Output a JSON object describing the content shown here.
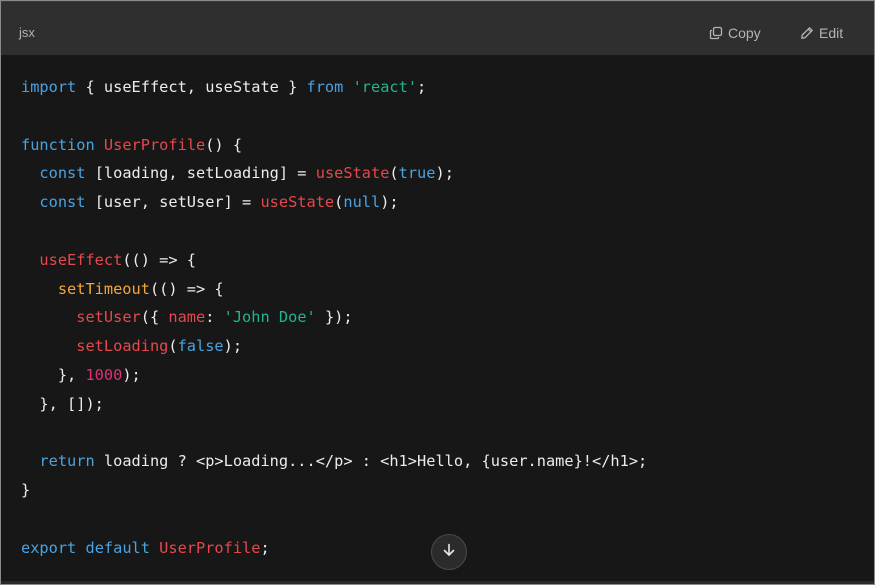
{
  "header": {
    "language": "jsx",
    "copy_label": "Copy",
    "edit_label": "Edit"
  },
  "icons": {
    "copy": "copy-icon",
    "edit": "pencil-icon",
    "scroll": "arrow-down-icon"
  },
  "colors": {
    "keyword": "#4aa3e0",
    "function": "#e5484d",
    "string": "#1fb58f",
    "number": "#df3079",
    "timeout": "#f2a73b",
    "text": "#ececec",
    "background": "#171717",
    "header_background": "#2f2f2f"
  },
  "code": {
    "lines": [
      [
        {
          "t": "import",
          "c": "keyword"
        },
        {
          "t": " { useEffect, useState } ",
          "c": "plain"
        },
        {
          "t": "from",
          "c": "keyword"
        },
        {
          "t": " ",
          "c": "plain"
        },
        {
          "t": "'react'",
          "c": "string"
        },
        {
          "t": ";",
          "c": "plain"
        }
      ],
      [],
      [
        {
          "t": "function",
          "c": "keyword"
        },
        {
          "t": " ",
          "c": "plain"
        },
        {
          "t": "UserProfile",
          "c": "func"
        },
        {
          "t": "() {",
          "c": "plain"
        }
      ],
      [
        {
          "t": "  ",
          "c": "plain"
        },
        {
          "t": "const",
          "c": "keyword"
        },
        {
          "t": " [loading, setLoading] = ",
          "c": "plain"
        },
        {
          "t": "useState",
          "c": "func"
        },
        {
          "t": "(",
          "c": "plain"
        },
        {
          "t": "true",
          "c": "bool"
        },
        {
          "t": ");",
          "c": "plain"
        }
      ],
      [
        {
          "t": "  ",
          "c": "plain"
        },
        {
          "t": "const",
          "c": "keyword"
        },
        {
          "t": " [user, setUser] = ",
          "c": "plain"
        },
        {
          "t": "useState",
          "c": "func"
        },
        {
          "t": "(",
          "c": "plain"
        },
        {
          "t": "null",
          "c": "bool"
        },
        {
          "t": ");",
          "c": "plain"
        }
      ],
      [],
      [
        {
          "t": "  ",
          "c": "plain"
        },
        {
          "t": "useEffect",
          "c": "func"
        },
        {
          "t": "(() => {",
          "c": "plain"
        }
      ],
      [
        {
          "t": "    ",
          "c": "plain"
        },
        {
          "t": "setTimeout",
          "c": "timeout"
        },
        {
          "t": "(() => {",
          "c": "plain"
        }
      ],
      [
        {
          "t": "      ",
          "c": "plain"
        },
        {
          "t": "setUser",
          "c": "func"
        },
        {
          "t": "({ ",
          "c": "plain"
        },
        {
          "t": "name",
          "c": "prop"
        },
        {
          "t": ": ",
          "c": "plain"
        },
        {
          "t": "'John Doe'",
          "c": "string"
        },
        {
          "t": " });",
          "c": "plain"
        }
      ],
      [
        {
          "t": "      ",
          "c": "plain"
        },
        {
          "t": "setLoading",
          "c": "func"
        },
        {
          "t": "(",
          "c": "plain"
        },
        {
          "t": "false",
          "c": "bool"
        },
        {
          "t": ");",
          "c": "plain"
        }
      ],
      [
        {
          "t": "    }, ",
          "c": "plain"
        },
        {
          "t": "1000",
          "c": "number"
        },
        {
          "t": ");",
          "c": "plain"
        }
      ],
      [
        {
          "t": "  }, []);",
          "c": "plain"
        }
      ],
      [],
      [
        {
          "t": "  ",
          "c": "plain"
        },
        {
          "t": "return",
          "c": "keyword"
        },
        {
          "t": " loading ? <p>Loading...</p> : <h1>Hello, {user.name}!</h1>;",
          "c": "plain"
        }
      ],
      [
        {
          "t": "}",
          "c": "plain"
        }
      ],
      [],
      [
        {
          "t": "export",
          "c": "keyword"
        },
        {
          "t": " ",
          "c": "plain"
        },
        {
          "t": "default",
          "c": "keyword"
        },
        {
          "t": " ",
          "c": "plain"
        },
        {
          "t": "UserProfile",
          "c": "func"
        },
        {
          "t": ";",
          "c": "plain"
        }
      ]
    ]
  }
}
